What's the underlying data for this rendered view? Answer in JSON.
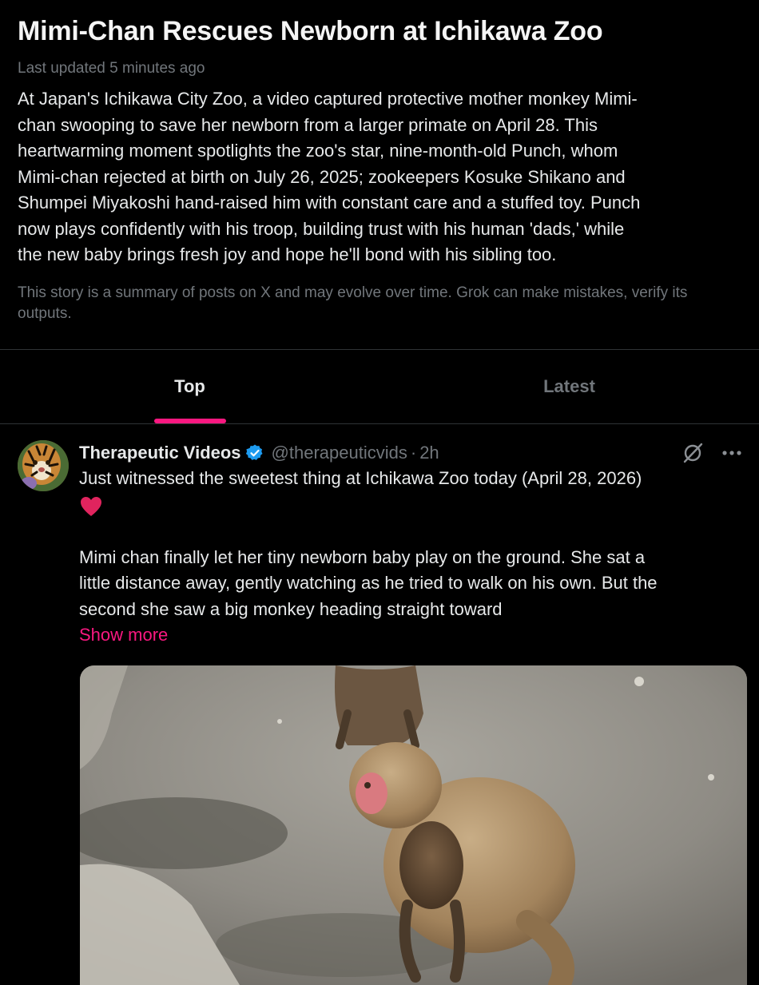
{
  "story": {
    "title": "Mimi-Chan Rescues Newborn at Ichikawa Zoo",
    "updated": "Last updated 5 minutes ago",
    "summary_lines": [
      "At Japan's Ichikawa City Zoo, a video captured protective mother monkey Mimi-",
      "chan swooping to save her newborn from a larger primate on April 28. This",
      "heartwarming moment spotlights the zoo's star, nine-month-old Punch, whom",
      "Mimi-chan rejected at birth on July 26, 2025; zookeepers Kosuke Shikano and",
      "Shumpei Miyakoshi hand-raised him with constant care and a stuffed toy. Punch",
      "now plays confidently with his troop, building trust with his human 'dads,' while",
      "the new baby brings fresh joy and hope he'll bond with his sibling too."
    ],
    "disclaimer": "This story is a summary of posts on X and may evolve over time. Grok can make mistakes, verify its outputs."
  },
  "tabs": [
    {
      "label": "Top",
      "active": true
    },
    {
      "label": "Latest",
      "active": false
    }
  ],
  "post": {
    "author": "Therapeutic Videos",
    "handle": "@therapeuticvids",
    "separator": "·",
    "time": "2h",
    "line1": "Just witnessed the sweetest thing at Ichikawa Zoo today (April 28, 2026)",
    "body_lines": [
      "Mimi chan finally let her tiny newborn baby play on the ground. She sat a",
      "little distance away, gently watching as he tried to walk on his own. But the",
      "second she saw a big monkey heading straight toward"
    ],
    "show_more": "Show more",
    "icons": [
      "grok-icon",
      "more-icon",
      "verified-icon",
      "heart-icon"
    ]
  },
  "colors": {
    "background": "#000000",
    "accent": "#f91880",
    "muted": "#71767b",
    "verified": "#1d9bf0",
    "heart": "#e0245e"
  }
}
